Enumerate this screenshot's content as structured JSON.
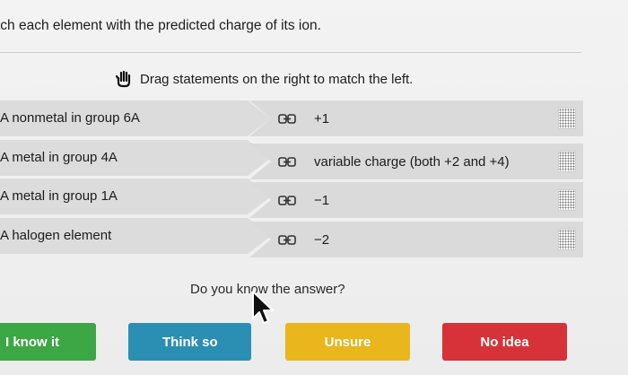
{
  "question": {
    "title": "tch each element with the predicted charge of its ion."
  },
  "instruction": {
    "text": "Drag statements on the right to match the left.",
    "icon": "hand-icon"
  },
  "left_items": [
    "A nonmetal in group 6A",
    "A metal in group 4A",
    "A metal in group 1A",
    "A halogen element"
  ],
  "right_items": [
    "+1",
    "variable charge (both +2 and +4)",
    "−1",
    "−2"
  ],
  "confidence": {
    "prompt": "Do you know the answer?",
    "buttons": {
      "know": "I know it",
      "think": "Think so",
      "unsure": "Unsure",
      "no_idea": "No idea"
    }
  },
  "colors": {
    "know": "#3ca744",
    "think": "#2b8fb3",
    "unsure": "#eab61e",
    "no_idea": "#d7323a"
  }
}
